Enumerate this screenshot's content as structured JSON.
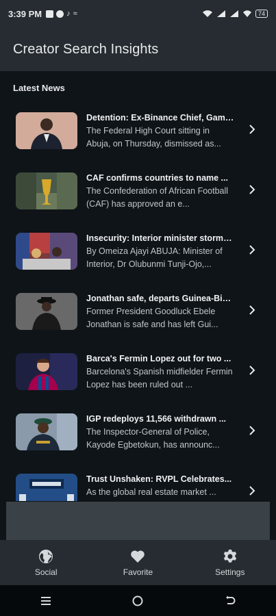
{
  "status_bar": {
    "time": "3:39 PM",
    "icons": [
      "v-app-icon",
      "messenger-icon",
      "tiktok-icon",
      "other-app-icon"
    ],
    "right_icons": [
      "wifi-icon",
      "signal-icon",
      "signal-icon",
      "vowifi-icon"
    ],
    "battery": "74"
  },
  "app": {
    "title": "Creator Search Insights"
  },
  "section": {
    "title": "Latest News"
  },
  "news": [
    {
      "headline": "Detention: Ex-Binance Chief, Gambaryan...",
      "summary": "The Federal High Court sitting in Abuja, on Thursday, dismissed as...",
      "thumb_icon": "man-in-suit-thumbnail"
    },
    {
      "headline": "CAF confirms countries to name ...",
      "summary": "The Confederation of African Football (CAF) has approved an e...",
      "thumb_icon": "trophy-thumbnail"
    },
    {
      "headline": "Insecurity: Interior minister storms...",
      "summary": "By Omeiza Ajayi ABUJA: Minister of Interior, Dr Olubunmi Tunji-Ojo,...",
      "thumb_icon": "crowd-thumbnail"
    },
    {
      "headline": "Jonathan safe, departs Guinea-Bissau...",
      "summary": "Former President Goodluck Ebele Jonathan is safe and has left Gui...",
      "thumb_icon": "jonathan-thumbnail"
    },
    {
      "headline": "Barca's Fermin Lopez out for two ...",
      "summary": "Barcelona's Spanish midfielder Fermin Lopez has been ruled out ...",
      "thumb_icon": "footballer-thumbnail"
    },
    {
      "headline": "IGP redeploys 11,566 withdrawn ...",
      "summary": "The Inspector-General of Police, Kayode Egbetokun, has announc...",
      "thumb_icon": "police-officer-thumbnail"
    },
    {
      "headline": "Trust Unshaken: RVPL Celebrates...",
      "summary": "As the global real estate market ...",
      "thumb_icon": "rosewood-thumbnail"
    }
  ],
  "bottom_nav": [
    {
      "label": "Social",
      "icon": "globe-icon"
    },
    {
      "label": "Favorite",
      "icon": "heart-icon"
    },
    {
      "label": "Settings",
      "icon": "gear-icon"
    }
  ],
  "system_nav": [
    "menu-icon",
    "home-icon",
    "back-icon"
  ],
  "colors": {
    "background": "#0f1418",
    "appbar": "#262c31",
    "panel": "#3a4147",
    "text": "#e6e8ea"
  }
}
